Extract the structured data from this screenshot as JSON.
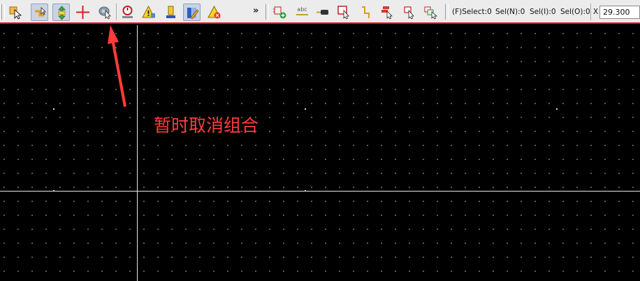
{
  "toolbar": {
    "tools_left": [
      {
        "name": "select-objects-icon",
        "pressed": false
      },
      {
        "name": "drag-connected-icon",
        "pressed": true
      },
      {
        "name": "move-group-icon",
        "pressed": true
      },
      {
        "name": "cross-probe-icon",
        "pressed": false
      },
      {
        "name": "temporarily-ungroup-icon",
        "pressed": false
      },
      {
        "name": "measure-icon",
        "pressed": false
      },
      {
        "name": "drc-warning-icon",
        "pressed": false
      },
      {
        "name": "net-color-icon",
        "pressed": false
      },
      {
        "name": "layer-pen-icon",
        "pressed": true
      },
      {
        "name": "clear-errors-icon",
        "pressed": false
      }
    ],
    "overflow_label": "»",
    "tools_right": [
      "add-part-icon",
      "text-abc-icon",
      "probe-icon",
      "select-region-icon",
      "wire-step-icon",
      "cross-select-icon",
      "pick-arrow-icon",
      "multi-select-icon"
    ],
    "status": {
      "f_select": "(F)Select:0",
      "sel_n": "Sel(N):0",
      "sel_i": "Sel(I):0",
      "sel_o": "Sel(O):0",
      "x_label": "X",
      "x_value": "29.300"
    }
  },
  "annotation": {
    "text": "暂时取消组合",
    "color": "#ff3b3b"
  },
  "colors": {
    "canvas_bg": "#000000",
    "grid_dot": "#6a6a6a",
    "crosshair": "#e8e8e8",
    "toolbar_border": "#cc2a2a"
  }
}
